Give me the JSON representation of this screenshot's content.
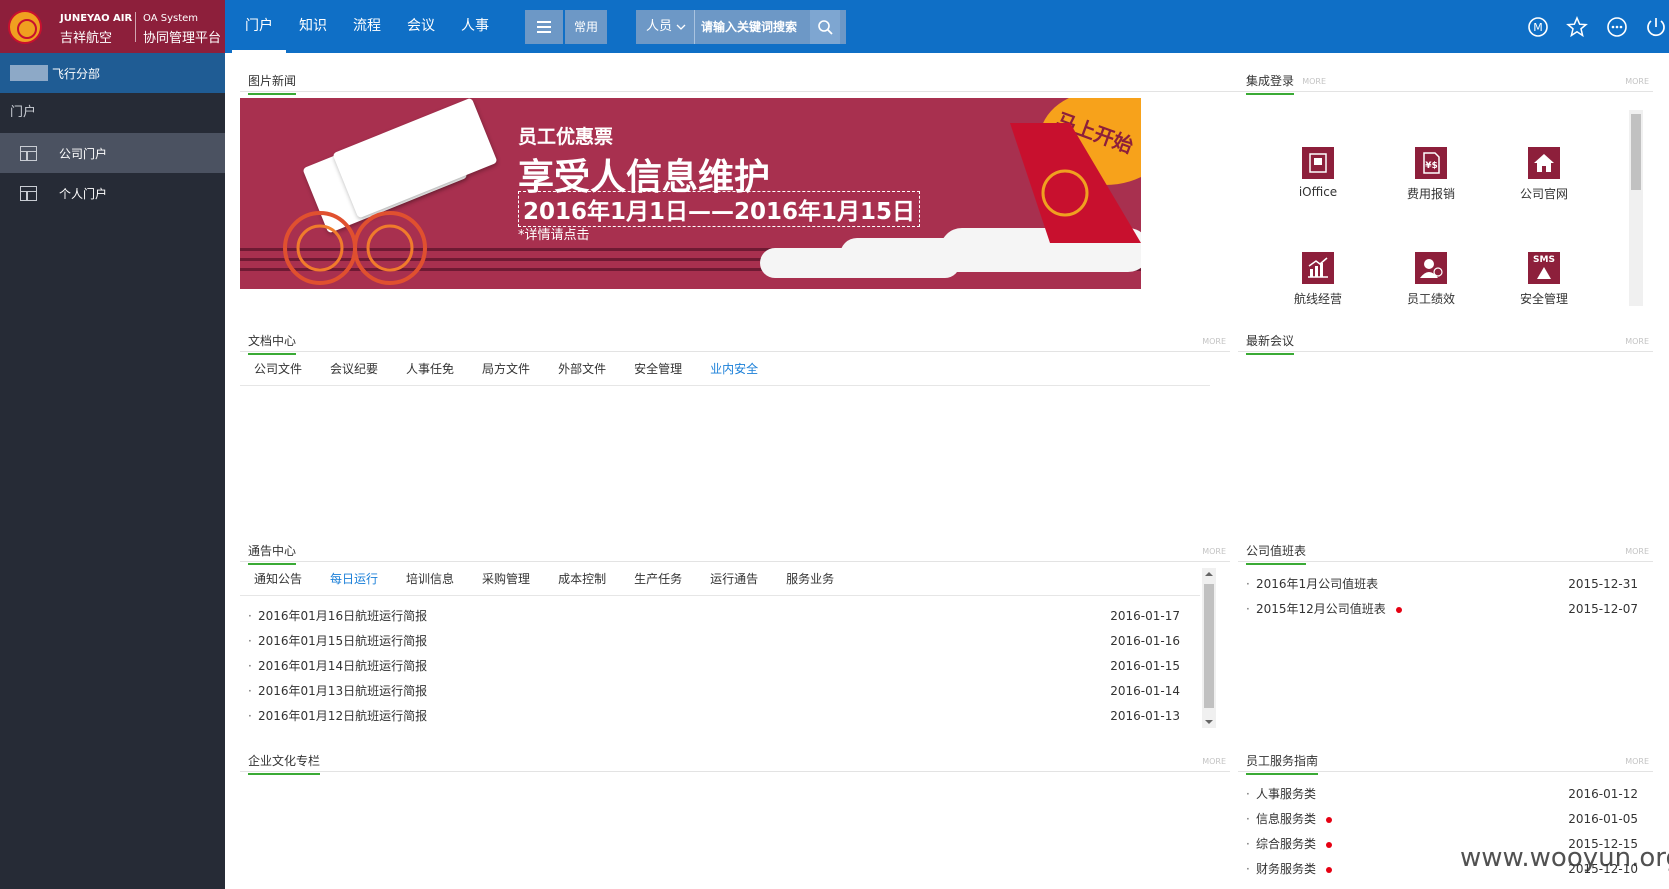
{
  "brand": {
    "en": "JUNEYAO AIR",
    "cn": "吉祥航空",
    "system": "OA System",
    "system_cn": "协同管理平台"
  },
  "nav": [
    "门户",
    "知识",
    "流程",
    "会议",
    "人事"
  ],
  "toolbar": {
    "common_label": "常用"
  },
  "search": {
    "category": "人员",
    "placeholder": "请输入关键词搜索"
  },
  "top_icons": [
    "m-badge-icon",
    "star-icon",
    "more-icon",
    "power-icon"
  ],
  "sidebar": {
    "dept": "飞行分部",
    "section_title": "门户",
    "items": [
      {
        "label": "公司门户",
        "active": true
      },
      {
        "label": "个人门户",
        "active": false
      }
    ]
  },
  "more_label": "MORE",
  "news": {
    "title": "图片新闻",
    "banner": {
      "line1": "员工优惠票",
      "line2": "享受人信息维护",
      "line3": "2016年1月1日——2016年1月15日",
      "line4": "*详情请点击",
      "bubble": "马上开始了"
    }
  },
  "integrated_login": {
    "title": "集成登录",
    "apps": [
      {
        "label": "iOffice",
        "icon": "id-card-icon"
      },
      {
        "label": "费用报销",
        "icon": "invoice-icon"
      },
      {
        "label": "公司官网",
        "icon": "home-icon"
      },
      {
        "label": "航线经营",
        "icon": "chart-up-icon"
      },
      {
        "label": "员工绩效",
        "icon": "user-icon"
      },
      {
        "label": "安全管理",
        "icon": "sms-warning-icon",
        "badge": "SMS"
      }
    ]
  },
  "docs": {
    "title": "文档中心",
    "tabs": [
      "公司文件",
      "会议纪要",
      "人事任免",
      "局方文件",
      "外部文件",
      "安全管理",
      "业内安全"
    ],
    "active_tab": 6
  },
  "latest_meetings": {
    "title": "最新会议"
  },
  "notices": {
    "title": "通告中心",
    "tabs": [
      "通知公告",
      "每日运行",
      "培训信息",
      "采购管理",
      "成本控制",
      "生产任务",
      "运行通告",
      "服务业务"
    ],
    "active_tab": 1,
    "items": [
      {
        "text": "2016年01月16日航班运行简报",
        "date": "2016-01-17"
      },
      {
        "text": "2016年01月15日航班运行简报",
        "date": "2016-01-16"
      },
      {
        "text": "2016年01月14日航班运行简报",
        "date": "2016-01-15"
      },
      {
        "text": "2016年01月13日航班运行简报",
        "date": "2016-01-14"
      },
      {
        "text": "2016年01月12日航班运行简报",
        "date": "2016-01-13"
      }
    ]
  },
  "duty": {
    "title": "公司值班表",
    "items": [
      {
        "text": "2016年1月公司值班表",
        "date": "2015-12-31",
        "new": false
      },
      {
        "text": "2015年12月公司值班表",
        "date": "2015-12-07",
        "new": true
      }
    ]
  },
  "culture": {
    "title": "企业文化专栏"
  },
  "service_guide": {
    "title": "员工服务指南",
    "items": [
      {
        "text": "人事服务类",
        "date": "2016-01-12",
        "new": false
      },
      {
        "text": "信息服务类",
        "date": "2016-01-05",
        "new": true
      },
      {
        "text": "综合服务类",
        "date": "2015-12-15",
        "new": true
      },
      {
        "text": "财务服务类",
        "date": "2015-12-10",
        "new": true
      }
    ]
  },
  "watermark": "www.wooyun.org",
  "colors": {
    "topbar": "#0f6fc6",
    "brand": "#8d1f3b",
    "sidebar": "#262b36",
    "accent_underline": "#3aaa35",
    "active_tab": "#1a7fd8",
    "new_dot": "#e60012"
  }
}
